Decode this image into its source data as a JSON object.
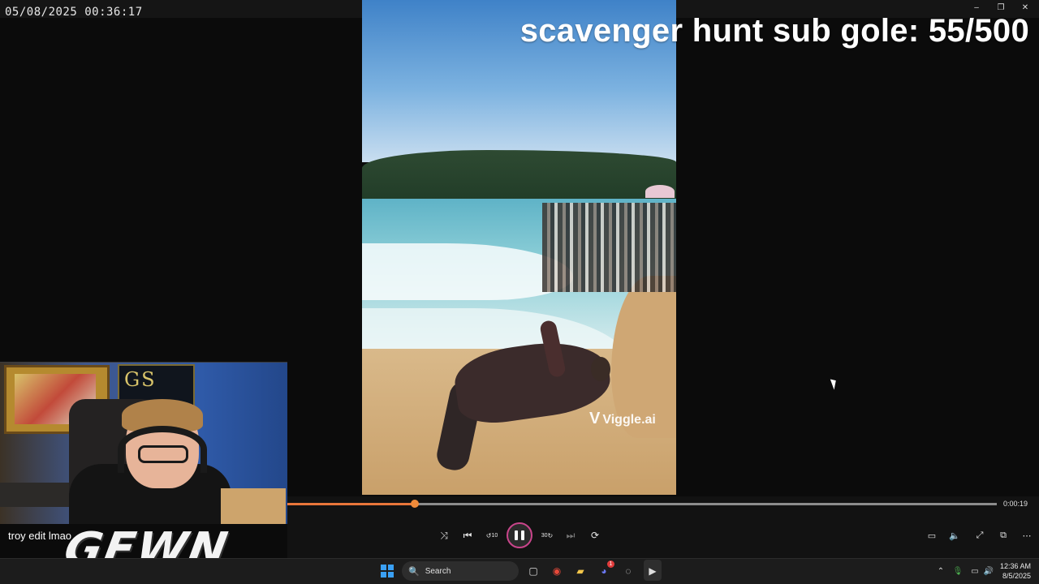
{
  "window": {
    "timestamp": "05/08/2025 00:36:17",
    "minimize": "–",
    "restore": "❐",
    "close": "✕"
  },
  "overlay": {
    "title": "scavenger hunt sub gole: 55/500",
    "sub_goal_current": 55,
    "sub_goal_target": 500
  },
  "video": {
    "watermark": "Viggle.ai"
  },
  "webcam": {
    "poster_text": "GS"
  },
  "stream": {
    "caption": "troy edit lmao",
    "brand_logo": "GEWN"
  },
  "player": {
    "time_remaining": "0:00:19",
    "progress_fraction": 0.18,
    "accent_color": "#e8763a",
    "buttons": {
      "shuffle": "shuffle-icon",
      "previous": "previous-icon",
      "rewind": "rewind-10-icon",
      "play_pause": "pause-icon",
      "forward": "forward-30-icon",
      "next": "next-icon",
      "repeat": "repeat-off-icon",
      "subtitles": "subtitles-icon",
      "volume": "volume-icon",
      "fullscreen": "fullscreen-icon",
      "miniplayer": "miniplayer-icon",
      "more": "more-icon"
    },
    "rewind_label": "10",
    "forward_label": "30"
  },
  "taskbar": {
    "search_placeholder": "Search",
    "apps": [
      {
        "name": "task-view-icon"
      },
      {
        "name": "chrome-icon",
        "badge": ""
      },
      {
        "name": "file-explorer-icon"
      },
      {
        "name": "discord-icon",
        "badge": "1"
      },
      {
        "name": "app-notification-icon"
      },
      {
        "name": "media-player-icon"
      }
    ],
    "time": "12:36 AM",
    "date": "8/5/2025"
  }
}
